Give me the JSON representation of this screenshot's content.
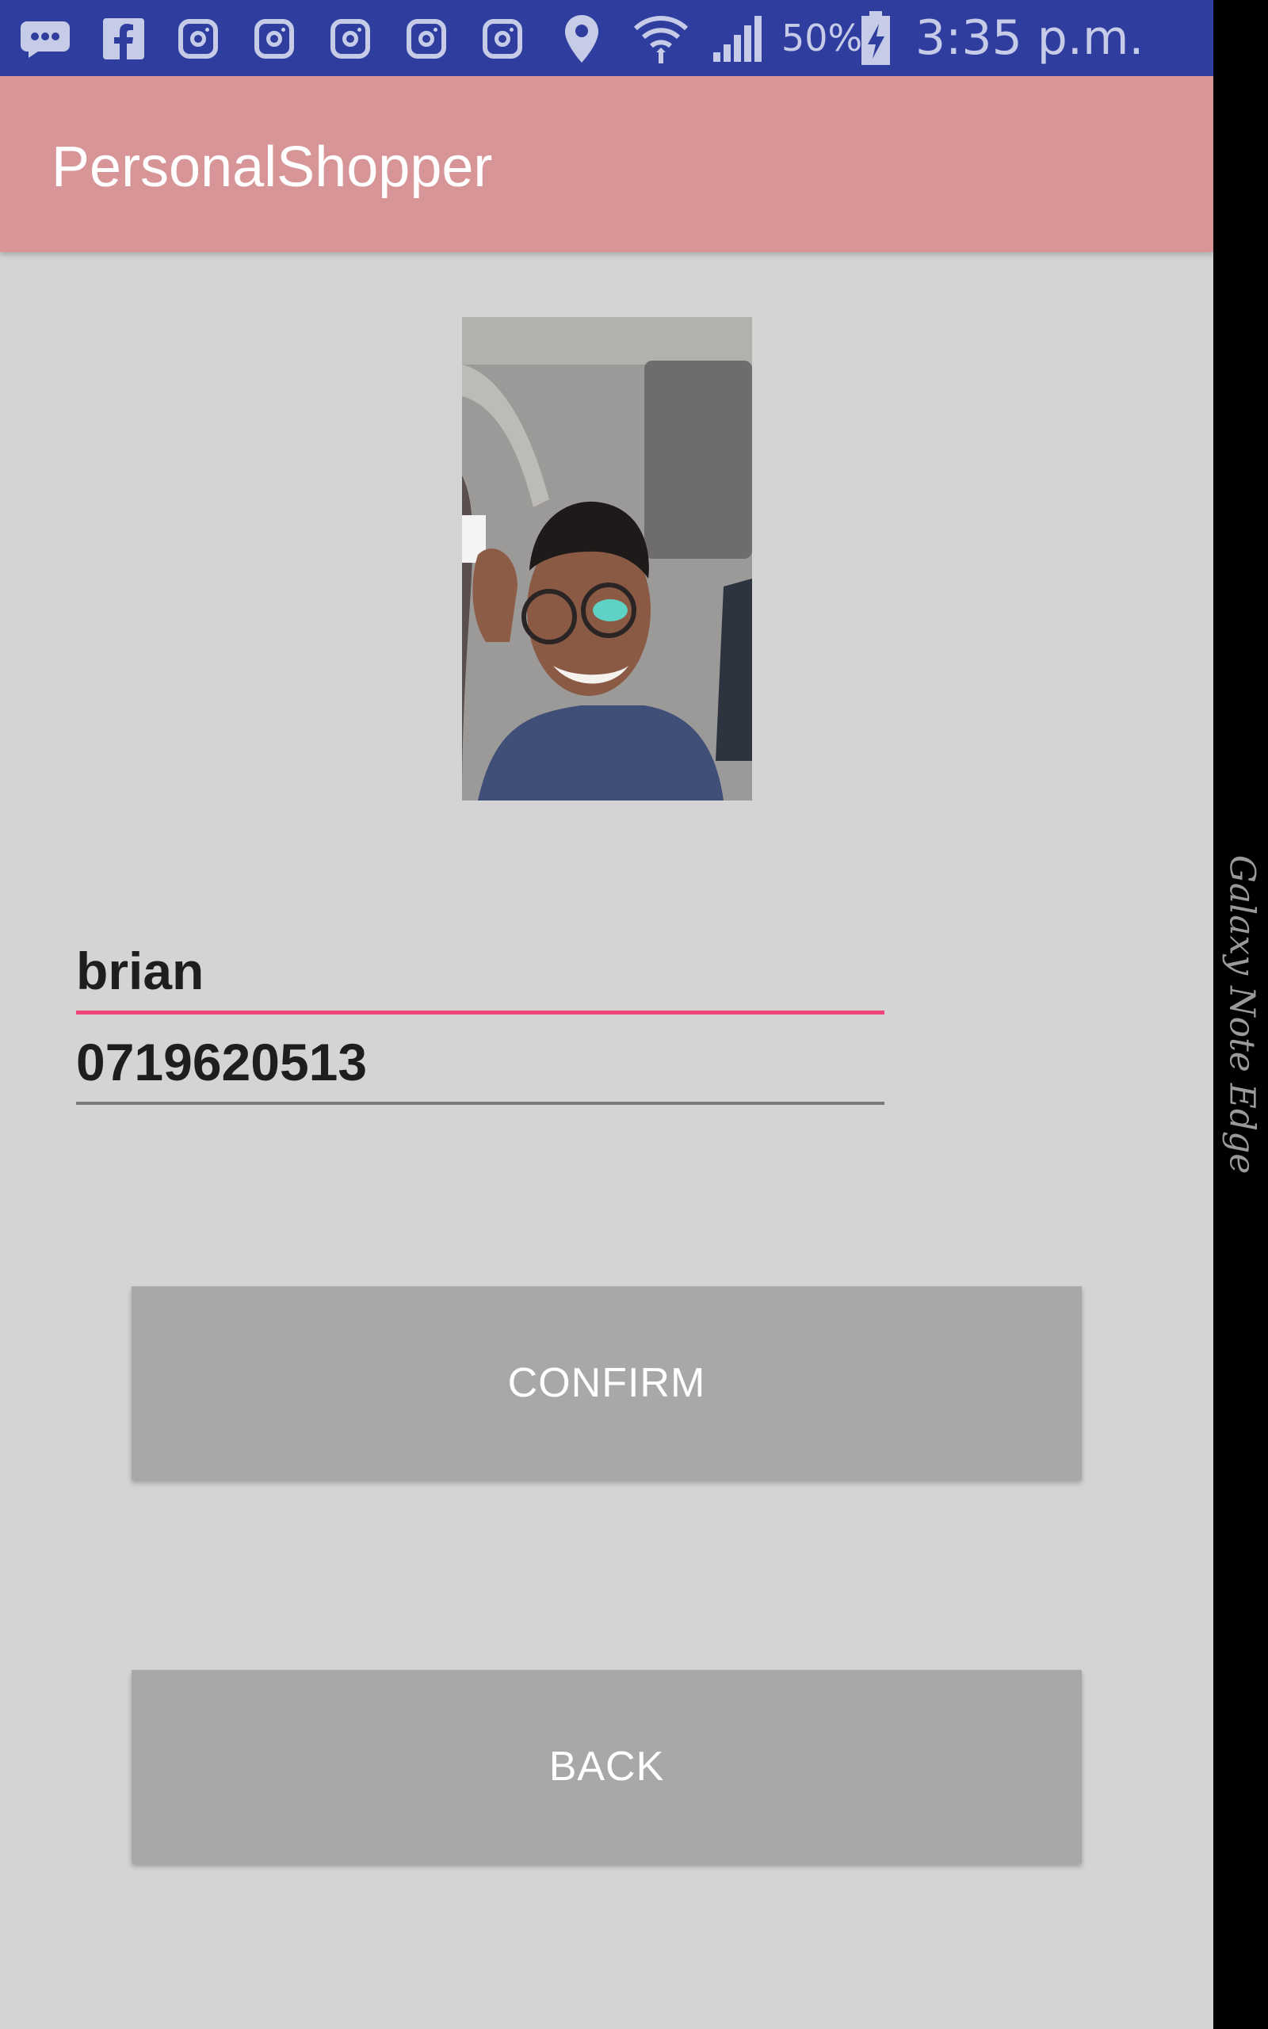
{
  "status_bar": {
    "battery": "50%",
    "time": "3:35 p.m.",
    "icons": [
      "messages-icon",
      "facebook-icon",
      "instagram-icon",
      "instagram-icon",
      "instagram-icon",
      "instagram-icon",
      "instagram-icon",
      "location-icon",
      "wifi-icon",
      "signal-icon",
      "battery-charging-icon"
    ]
  },
  "app_bar": {
    "title": "PersonalShopper"
  },
  "profile": {
    "photo_alt": "profile-photo",
    "name": "brian",
    "phone": "0719620513"
  },
  "actions": {
    "confirm_label": "CONFIRM",
    "back_label": "BACK"
  },
  "device": {
    "edge_label": "Galaxy Note Edge"
  },
  "colors": {
    "status_bar": "#2f3e9e",
    "app_bar": "#d79597",
    "accent": "#f0447a",
    "button": "#a8a8a8",
    "background": "#d4d4d4"
  }
}
